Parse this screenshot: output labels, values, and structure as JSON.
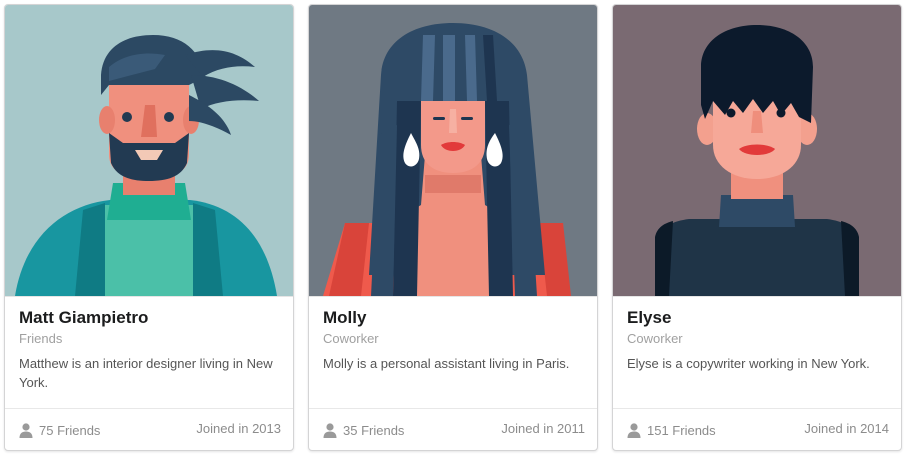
{
  "cards": [
    {
      "name": "Matt Giampietro",
      "meta": "Friends",
      "description": "Matthew is an interior designer living in New York.",
      "friends": "75 Friends",
      "joined": "Joined in 2013",
      "image_bg": "#a7c8ca"
    },
    {
      "name": "Molly",
      "meta": "Coworker",
      "description": "Molly is a personal assistant living in Paris.",
      "friends": "35 Friends",
      "joined": "Joined in 2011",
      "image_bg": "#6f7983"
    },
    {
      "name": "Elyse",
      "meta": "Coworker",
      "description": "Elyse is a copywriter working in New York.",
      "friends": "151 Friends",
      "joined": "Joined in 2014",
      "image_bg": "#7a6a72"
    }
  ],
  "icons": {
    "friends": "user-icon"
  }
}
